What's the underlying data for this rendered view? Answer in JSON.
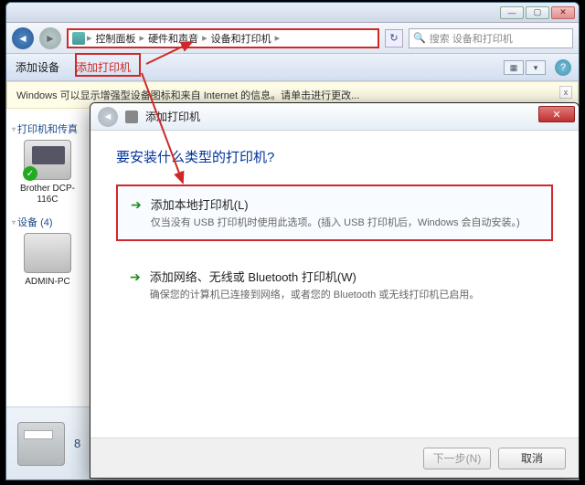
{
  "window": {
    "min": "—",
    "max": "▢",
    "close": "✕"
  },
  "breadcrumb": {
    "items": [
      "控制面板",
      "硬件和声音",
      "设备和打印机"
    ]
  },
  "search": {
    "placeholder": "搜索 设备和打印机"
  },
  "toolbar": {
    "add_device": "添加设备",
    "add_printer": "添加打印机",
    "help": "?"
  },
  "infobar": {
    "text": "Windows 可以显示增强型设备图标和来自 Internet 的信息。请单击进行更改...",
    "close": "x"
  },
  "groups": {
    "printers": {
      "header": "打印机和传真"
    },
    "devices": {
      "header": "设备 (4)"
    }
  },
  "devices": {
    "printer": {
      "label": "Brother DCP-116C"
    },
    "pc": {
      "label": "ADMIN-PC"
    }
  },
  "statusbar": {
    "count": "8 "
  },
  "dialog": {
    "title": "添加打印机",
    "heading": "要安装什么类型的打印机?",
    "option1": {
      "title": "添加本地打印机(L)",
      "desc": "仅当没有 USB 打印机时使用此选项。(插入 USB 打印机后，Windows 会自动安装。)"
    },
    "option2": {
      "title": "添加网络、无线或 Bluetooth 打印机(W)",
      "desc": "确保您的计算机已连接到网络，或者您的 Bluetooth 或无线打印机已启用。"
    },
    "next": "下一步(N)",
    "cancel": "取消"
  }
}
